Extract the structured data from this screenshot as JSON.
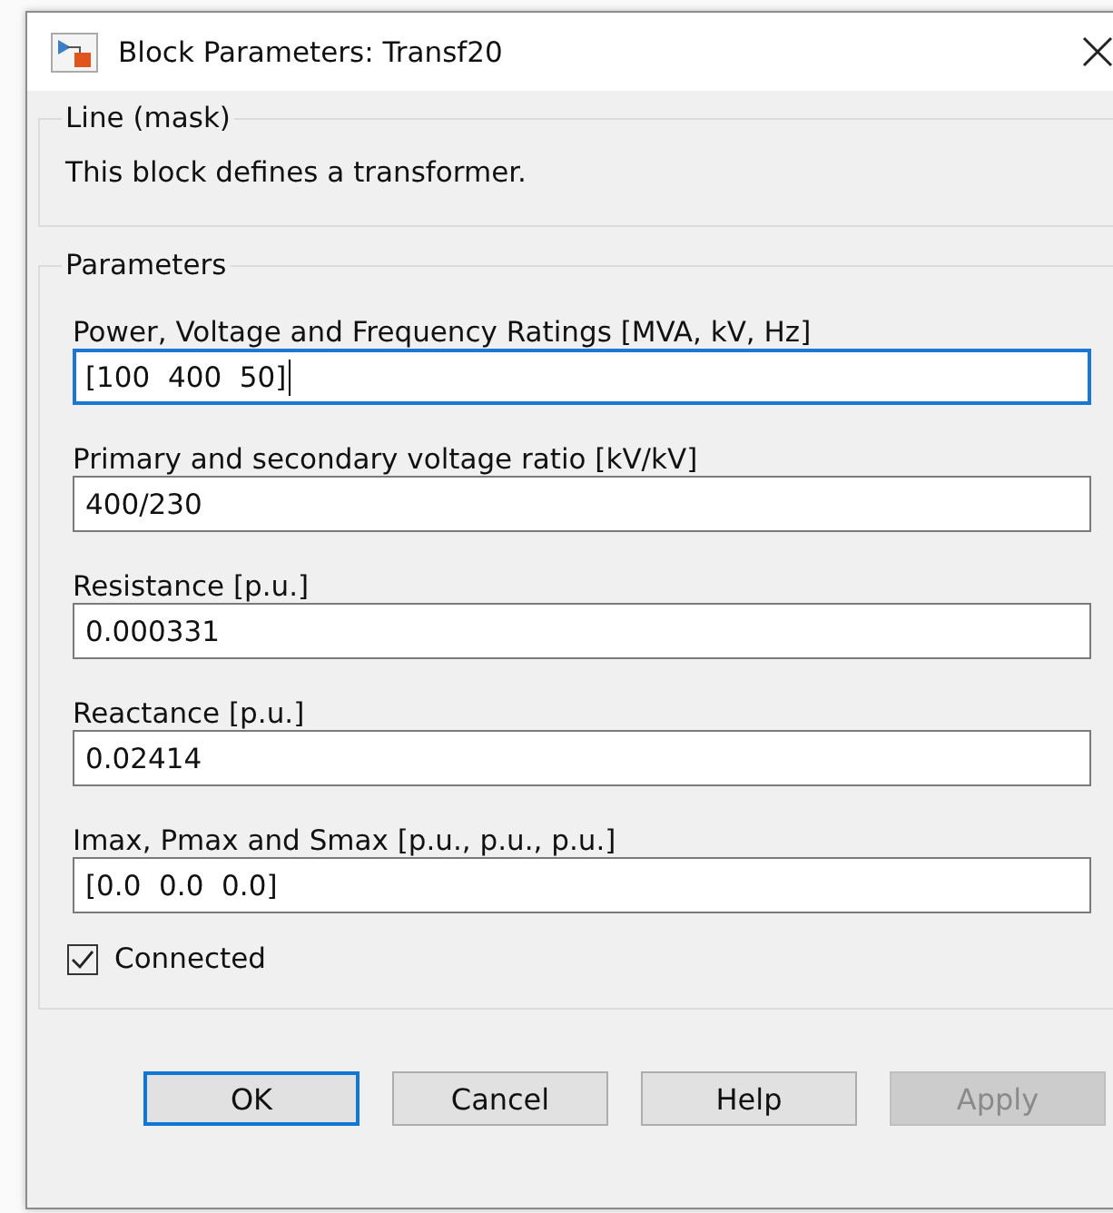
{
  "window": {
    "title": "Block Parameters: Transf20"
  },
  "description_group": {
    "legend": "Line (mask)",
    "text": "This block defines a transformer."
  },
  "parameters_group": {
    "legend": "Parameters",
    "fields": [
      {
        "label": "Power, Voltage and Frequency Ratings [MVA, kV, Hz]",
        "value": "[100  400  50]",
        "focused": true
      },
      {
        "label": "Primary and secondary voltage ratio [kV/kV]",
        "value": "400/230",
        "focused": false
      },
      {
        "label": "Resistance [p.u.]",
        "value": "0.000331",
        "focused": false
      },
      {
        "label": "Reactance [p.u.]",
        "value": "0.02414",
        "focused": false
      },
      {
        "label": "Imax, Pmax and Smax [p.u., p.u., p.u.]",
        "value": "[0.0  0.0  0.0]",
        "focused": false
      }
    ],
    "checkbox": {
      "label": "Connected",
      "checked": true
    }
  },
  "buttons": [
    {
      "label": "OK",
      "default": true,
      "disabled": false
    },
    {
      "label": "Cancel",
      "default": false,
      "disabled": false
    },
    {
      "label": "Help",
      "default": false,
      "disabled": false
    },
    {
      "label": "Apply",
      "default": false,
      "disabled": true
    }
  ]
}
